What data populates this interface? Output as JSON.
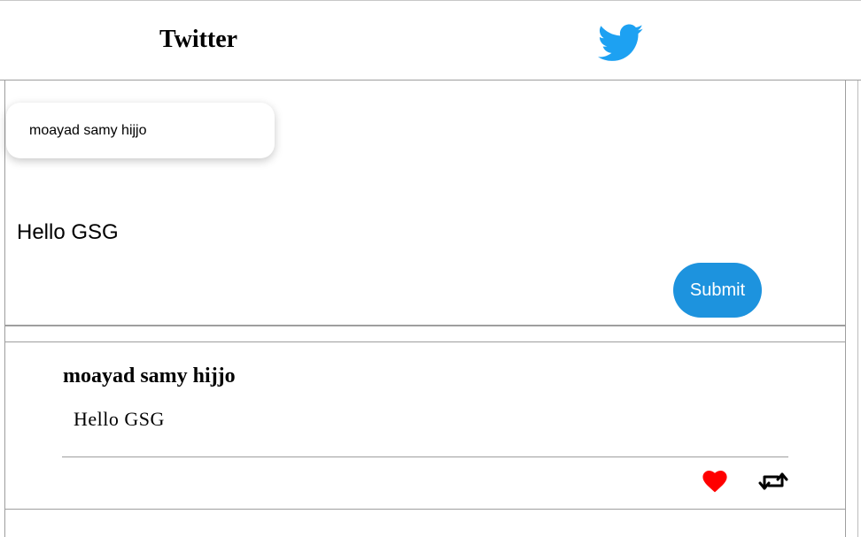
{
  "header": {
    "title": "Twitter",
    "logo_icon": "twitter-bird-icon",
    "logo_color": "#1da1f2"
  },
  "composer": {
    "name_input_value": "moayad samy hijjo",
    "tweet_input_value": "Hello GSG",
    "submit_label": "Submit",
    "submit_color": "#1d93de"
  },
  "feed": {
    "tweets": [
      {
        "author": "moayad samy hijjo",
        "text": "Hello GSG",
        "actions": [
          {
            "icon": "heart-icon",
            "color": "#ff0000"
          },
          {
            "icon": "retweet-icon",
            "color": "#000000"
          }
        ]
      }
    ]
  }
}
